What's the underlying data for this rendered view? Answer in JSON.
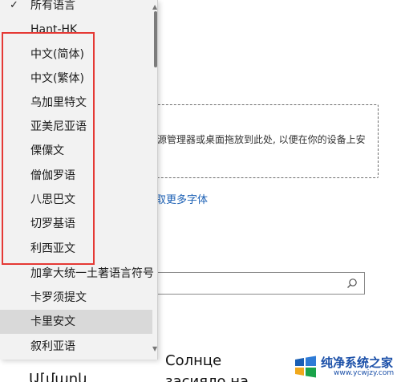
{
  "background": {
    "drop_text": "源管理器或桌面拖放到此处, 以便在你的设备上安",
    "more_fonts_link": "取更多字体",
    "search_placeholder": "",
    "preview_ru_line1": "Солнце",
    "preview_ru_line2": "засияло на",
    "preview_arm": "Ա[մարև"
  },
  "dropdown": {
    "items": [
      {
        "label": "所有语言",
        "selected": true
      },
      {
        "label": "Hant-HK"
      },
      {
        "label": "中文(简体)"
      },
      {
        "label": "中文(繁体)"
      },
      {
        "label": "乌加里特文"
      },
      {
        "label": "亚美尼亚语"
      },
      {
        "label": "傈僳文"
      },
      {
        "label": "僧伽罗语"
      },
      {
        "label": "八思巴文"
      },
      {
        "label": "切罗基语"
      },
      {
        "label": "利西亚文"
      },
      {
        "label": "加拿大统一土著语言符号"
      },
      {
        "label": "卡罗须提文"
      },
      {
        "label": "卡里安文",
        "hover": true
      },
      {
        "label": "叙利亚语"
      }
    ]
  },
  "watermark": {
    "title": "纯净系统之家",
    "url": "www.ycwjzy.com"
  },
  "colors": {
    "highlight": "#e53935",
    "link": "#1a5fb4",
    "dropdown_bg": "#f2f2f2"
  }
}
